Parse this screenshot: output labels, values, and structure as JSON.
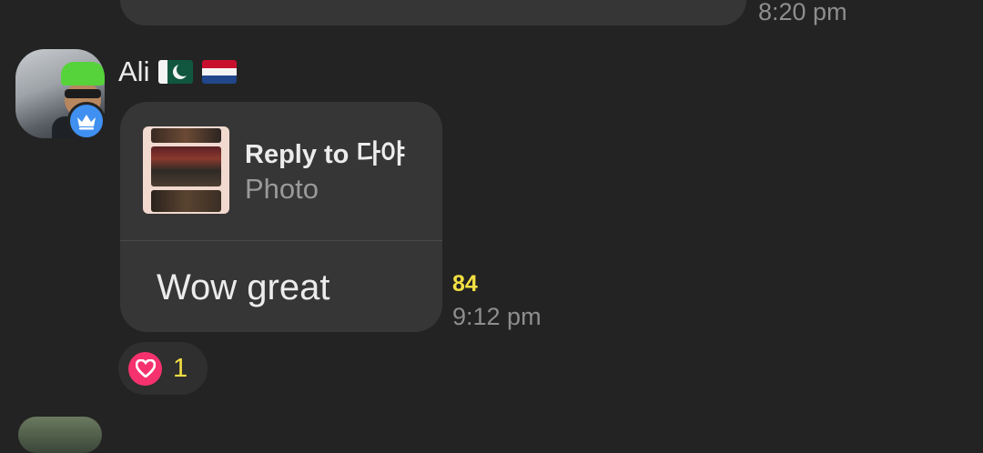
{
  "previous_message": {
    "time": "8:20 pm"
  },
  "message": {
    "sender": {
      "name": "Ali",
      "flags": [
        "pakistan-flag",
        "netherlands-flag"
      ],
      "badge_icon": "crown-icon",
      "badge_color": "#3f90f0"
    },
    "reply": {
      "title": "Reply to 다야",
      "subtitle": "Photo"
    },
    "text": "Wow great",
    "read_count": "84",
    "time": "9:12 pm"
  },
  "reaction": {
    "icon": "heart-icon",
    "count": "1",
    "color": "#f5326e"
  },
  "colors": {
    "background": "#232323",
    "bubble": "#363636",
    "accent_yellow": "#f4e043"
  }
}
